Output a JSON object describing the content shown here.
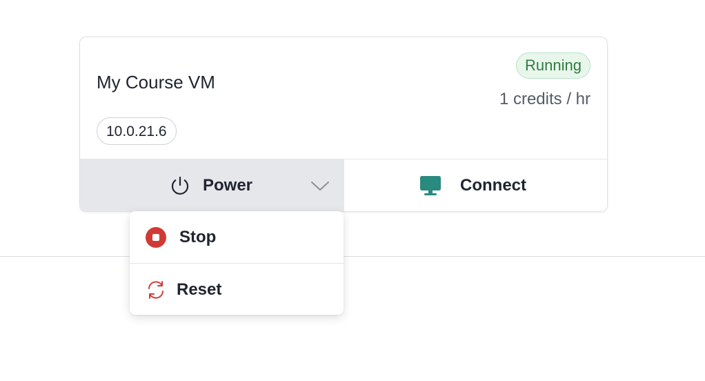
{
  "vm": {
    "name": "My Course VM",
    "ip": "10.0.21.6",
    "status": "Running",
    "credits": "1 credits / hr"
  },
  "actions": {
    "power_label": "Power",
    "connect_label": "Connect"
  },
  "power_menu": {
    "items": [
      {
        "label": "Stop",
        "icon": "stop-circle-icon"
      },
      {
        "label": "Reset",
        "icon": "refresh-icon"
      }
    ]
  },
  "colors": {
    "status_green": "#2e7d3e",
    "status_bg": "#e8f6ec",
    "stop_red": "#d13a34",
    "connect_teal": "#2a8a80",
    "power_bg": "#e6e7ea"
  },
  "icons": {
    "power": "power-icon",
    "chevron": "chevron-down-icon",
    "connect": "monitor-icon"
  }
}
